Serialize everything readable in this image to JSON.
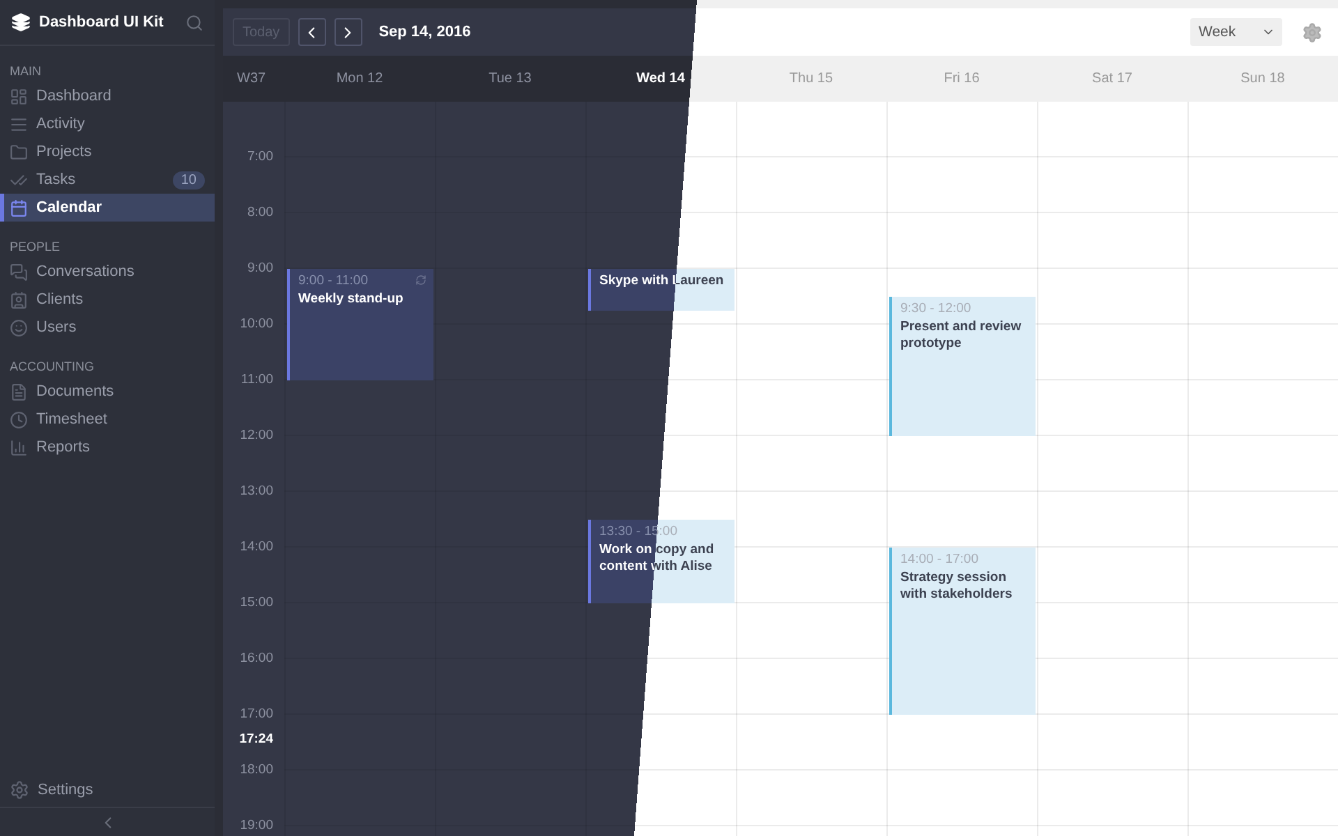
{
  "sidebar": {
    "brand": "Dashboard UI Kit",
    "sections": [
      {
        "title": "MAIN",
        "items": [
          {
            "label": "Dashboard",
            "selected": false
          },
          {
            "label": "Activity",
            "selected": false
          },
          {
            "label": "Projects",
            "selected": false
          },
          {
            "label": "Tasks",
            "badge": "10",
            "selected": false
          },
          {
            "label": "Calendar",
            "selected": true
          }
        ]
      },
      {
        "title": "PEOPLE",
        "items": [
          {
            "label": "Conversations",
            "selected": false
          },
          {
            "label": "Clients",
            "selected": false
          },
          {
            "label": "Users",
            "selected": false
          }
        ]
      },
      {
        "title": "ACCOUNTING",
        "items": [
          {
            "label": "Documents",
            "selected": false
          },
          {
            "label": "Timesheet",
            "selected": false
          },
          {
            "label": "Reports",
            "selected": false
          }
        ]
      }
    ],
    "settings": "Settings"
  },
  "toolbar": {
    "today": {
      "label": "Today",
      "disabled": true
    },
    "date": "Sep 14, 2016",
    "view": "Week"
  },
  "calendar": {
    "week": "W37",
    "days": [
      {
        "label": "Mon 12",
        "selected": false,
        "events": [
          {
            "time": "9:00 - 11:00",
            "title": "Weekly stand-up",
            "recurring": true
          }
        ]
      },
      {
        "label": "Tue 13",
        "selected": false
      },
      {
        "label": "Wed 14",
        "selected": true,
        "events": [
          {
            "title": "Skype with Laureen",
            "recurring": false
          },
          {
            "time": "13:30 - 15:00",
            "title": "Work on copy and content with Alise",
            "recurring": false
          }
        ]
      },
      {
        "label": "Thu 15",
        "selected": false
      },
      {
        "label": "Fri 16",
        "selected": false,
        "events": [
          {
            "time": "9:30 - 12:00",
            "title": "Present and review prototype",
            "recurring": false
          },
          {
            "time": "14:00 - 17:00",
            "title": "Strategy session with stakeholders",
            "recurring": false
          }
        ]
      },
      {
        "label": "Sat 17",
        "selected": false
      },
      {
        "label": "Sun 18",
        "selected": false
      }
    ],
    "hours": [
      "7:00",
      "8:00",
      "9:00",
      "10:00",
      "11:00",
      "12:00",
      "13:00",
      "14:00",
      "15:00",
      "16:00",
      "17:00",
      "18:00",
      "19:00"
    ],
    "now": "17:24"
  }
}
